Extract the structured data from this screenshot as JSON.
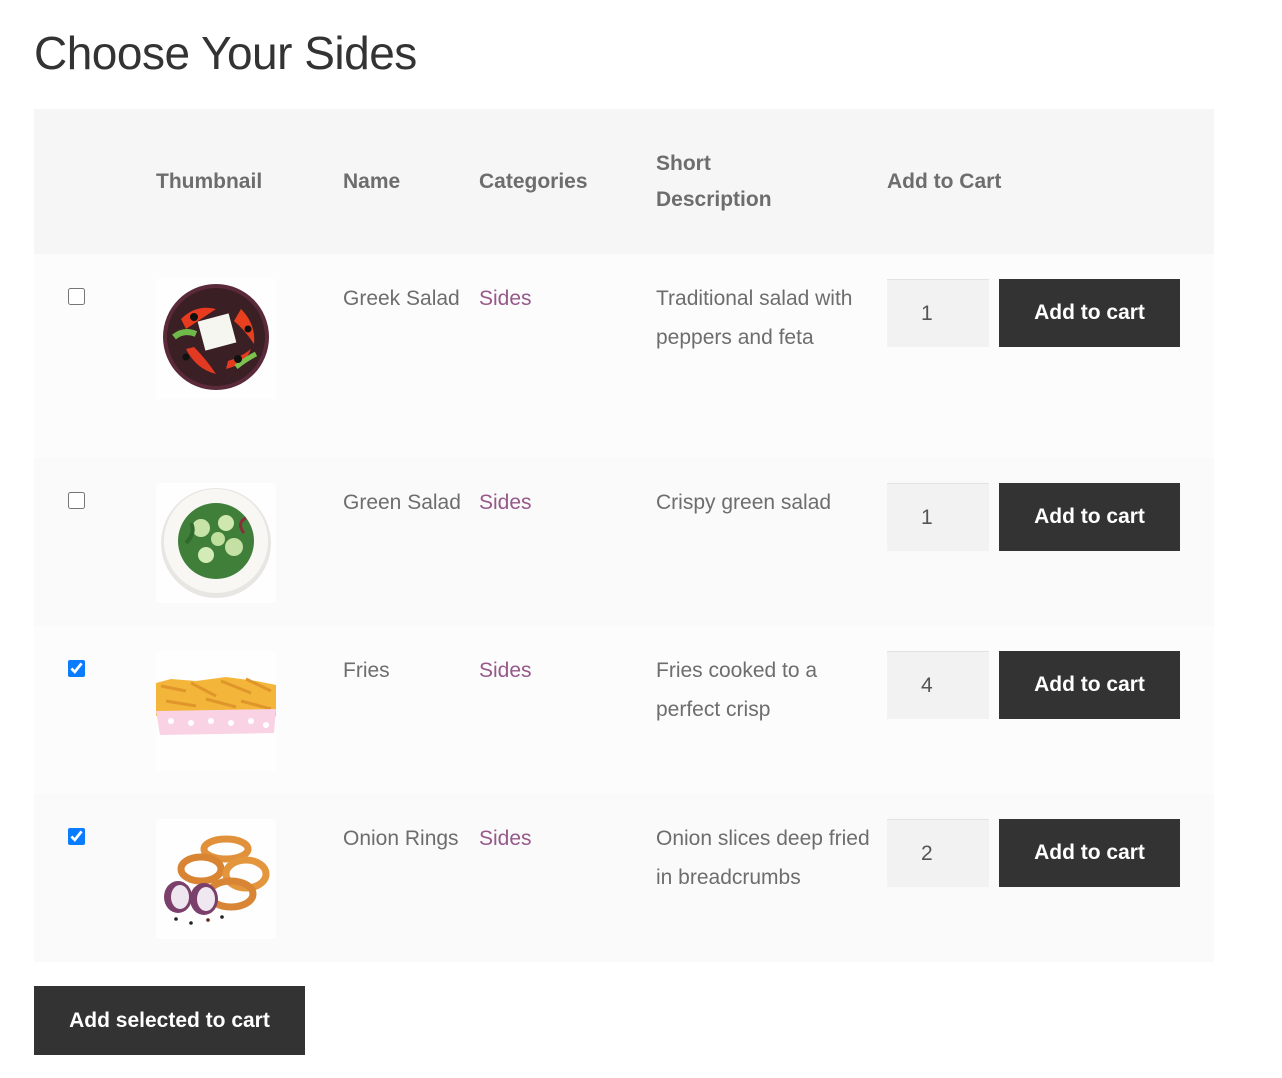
{
  "page": {
    "title": "Choose Your Sides"
  },
  "table": {
    "headers": {
      "thumbnail": "Thumbnail",
      "name": "Name",
      "categories": "Categories",
      "short_description_line1": "Short",
      "short_description_line2": "Description",
      "add_to_cart": "Add to Cart"
    },
    "rows": [
      {
        "selected": false,
        "thumbnail": "greek-salad-image",
        "name": "Greek Salad",
        "category": "Sides",
        "description": "Traditional salad with peppers and feta",
        "quantity": "1",
        "button_label": "Add to cart"
      },
      {
        "selected": false,
        "thumbnail": "green-salad-image",
        "name": "Green Salad",
        "category": "Sides",
        "description": "Crispy green salad",
        "quantity": "1",
        "button_label": "Add to cart"
      },
      {
        "selected": true,
        "thumbnail": "fries-image",
        "name": "Fries",
        "category": "Sides",
        "description": "Fries cooked to a perfect crisp",
        "quantity": "4",
        "button_label": "Add to cart"
      },
      {
        "selected": true,
        "thumbnail": "onion-rings-image",
        "name": "Onion Rings",
        "category": "Sides",
        "description": "Onion slices deep fried in breadcrumbs",
        "quantity": "2",
        "button_label": "Add to cart"
      }
    ]
  },
  "footer": {
    "add_selected_label": "Add selected to cart"
  },
  "colors": {
    "button_bg": "#333333",
    "link": "#96588a",
    "checkbox_accent": "#0a7cff",
    "header_bg": "#f6f6f6"
  }
}
